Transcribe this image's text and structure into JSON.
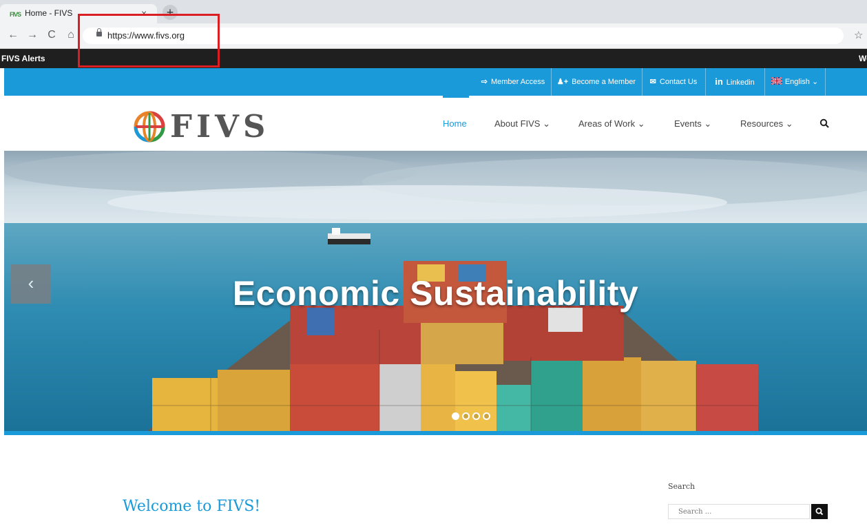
{
  "browser": {
    "tab_title": "Home - FIVS",
    "tab_favicon_text": "FIVS",
    "tab_close": "×",
    "new_tab": "+",
    "url": "https://www.fivs.org",
    "back_icon": "←",
    "forward_icon": "→",
    "reload_icon": "C",
    "home_icon": "⌂",
    "star_icon": "☆"
  },
  "alertbar": {
    "label": "FIVS Alerts",
    "right_text": "We"
  },
  "utility_nav": [
    {
      "icon": "sign-in-icon",
      "glyph": "⇨",
      "label": "Member Access"
    },
    {
      "icon": "add-user-icon",
      "glyph": "♟+",
      "label": "Become a Member"
    },
    {
      "icon": "envelope-icon",
      "glyph": "✉",
      "label": "Contact Us"
    },
    {
      "icon": "linkedin-icon",
      "glyph": "in",
      "label": "Linkedin"
    },
    {
      "icon": "uk-flag-icon",
      "glyph": "",
      "label": "English ⌄"
    }
  ],
  "logo": {
    "text": "FIVS"
  },
  "main_nav": [
    {
      "label": "Home",
      "active": true
    },
    {
      "label": "About FIVS ⌄"
    },
    {
      "label": "Areas of Work ⌄"
    },
    {
      "label": "Events ⌄"
    },
    {
      "label": "Resources ⌄"
    }
  ],
  "hero": {
    "title": "Economic Sustainability",
    "prev_glyph": "‹",
    "slide_count": 4,
    "active_slide": 1
  },
  "content": {
    "welcome_heading": "Welcome to FIVS!"
  },
  "sidebar_search": {
    "heading": "Search",
    "placeholder": "Search ..."
  },
  "colors": {
    "brand_blue": "#1a9ad9",
    "alert_bar": "#1f1f1f",
    "highlight_red": "#d91e24"
  }
}
